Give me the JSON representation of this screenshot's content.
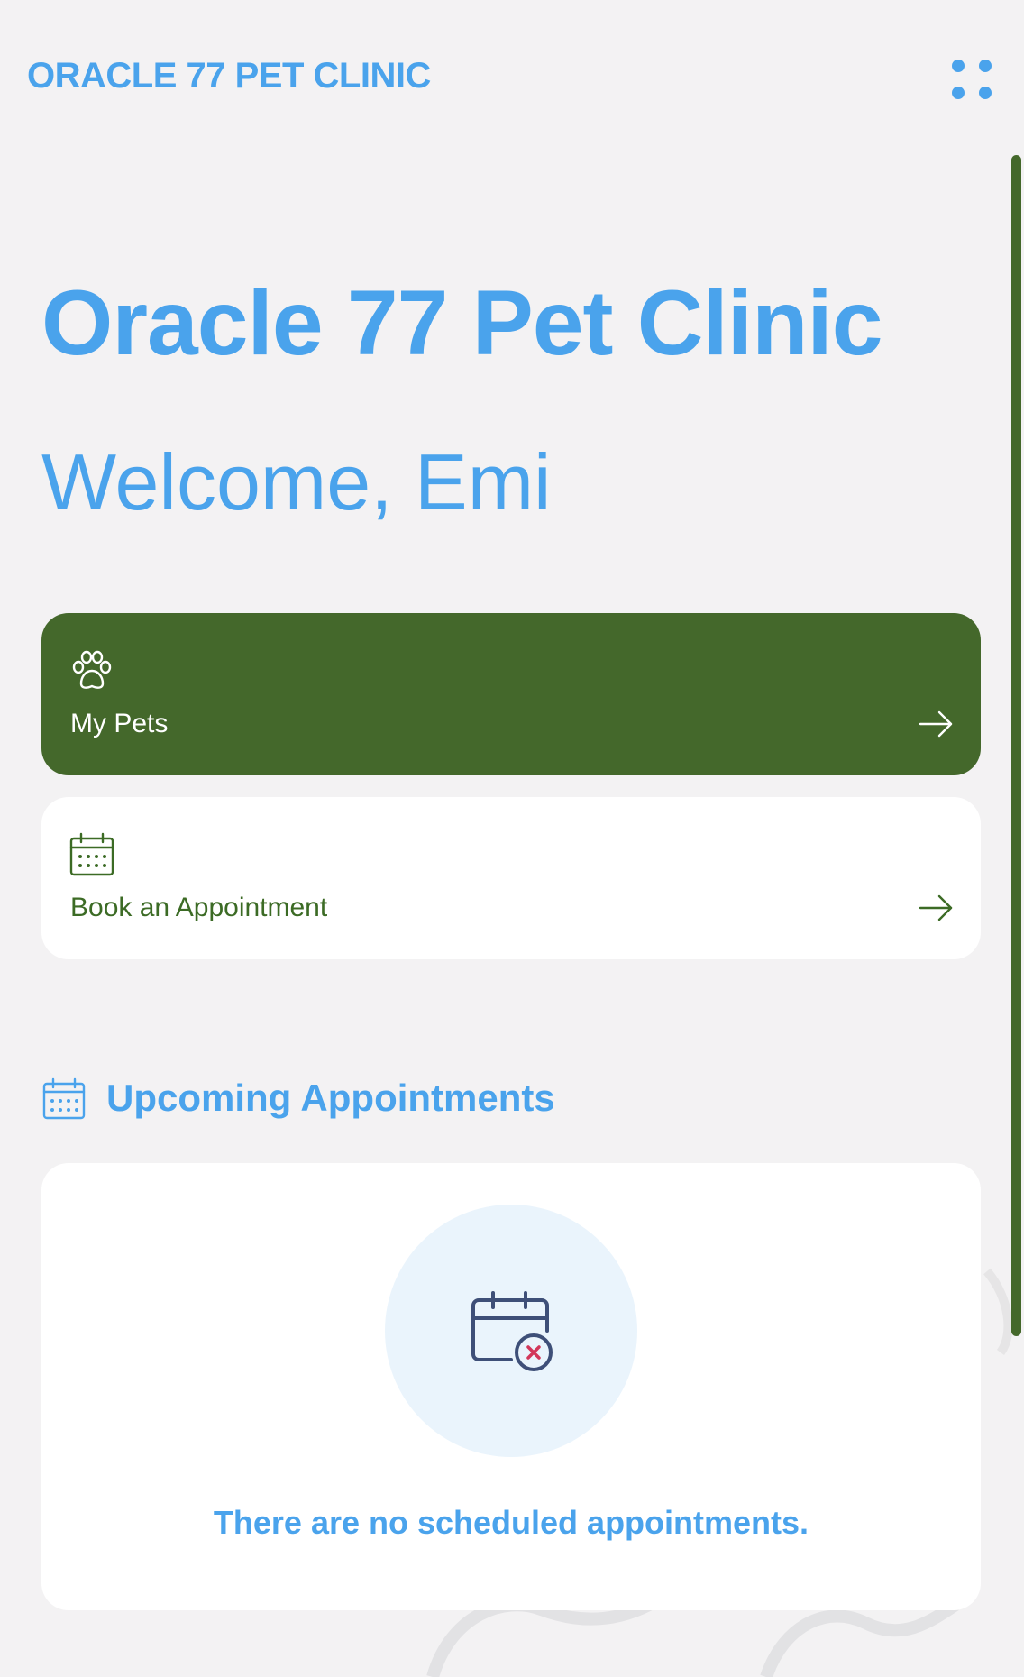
{
  "header": {
    "brand": "ORACLE 77 PET CLINIC",
    "menu_icon": "dots-grid-icon"
  },
  "hero": {
    "title": "Oracle 77 Pet Clinic",
    "welcome": "Welcome, Emi"
  },
  "actions": [
    {
      "label": "My Pets",
      "icon": "paw-icon",
      "arrow": "arrow-right-icon"
    },
    {
      "label": "Book an Appointment",
      "icon": "calendar-icon",
      "arrow": "arrow-right-icon"
    }
  ],
  "upcoming": {
    "title": "Upcoming Appointments",
    "icon": "calendar-icon",
    "empty_icon": "calendar-x-icon",
    "empty_message": "There are no scheduled appointments."
  },
  "colors": {
    "accent_blue": "#4aa3ec",
    "brand_green": "#44682b",
    "background": "#f3f2f3",
    "empty_circle": "#eaf4fc",
    "error_red": "#d2375a"
  }
}
